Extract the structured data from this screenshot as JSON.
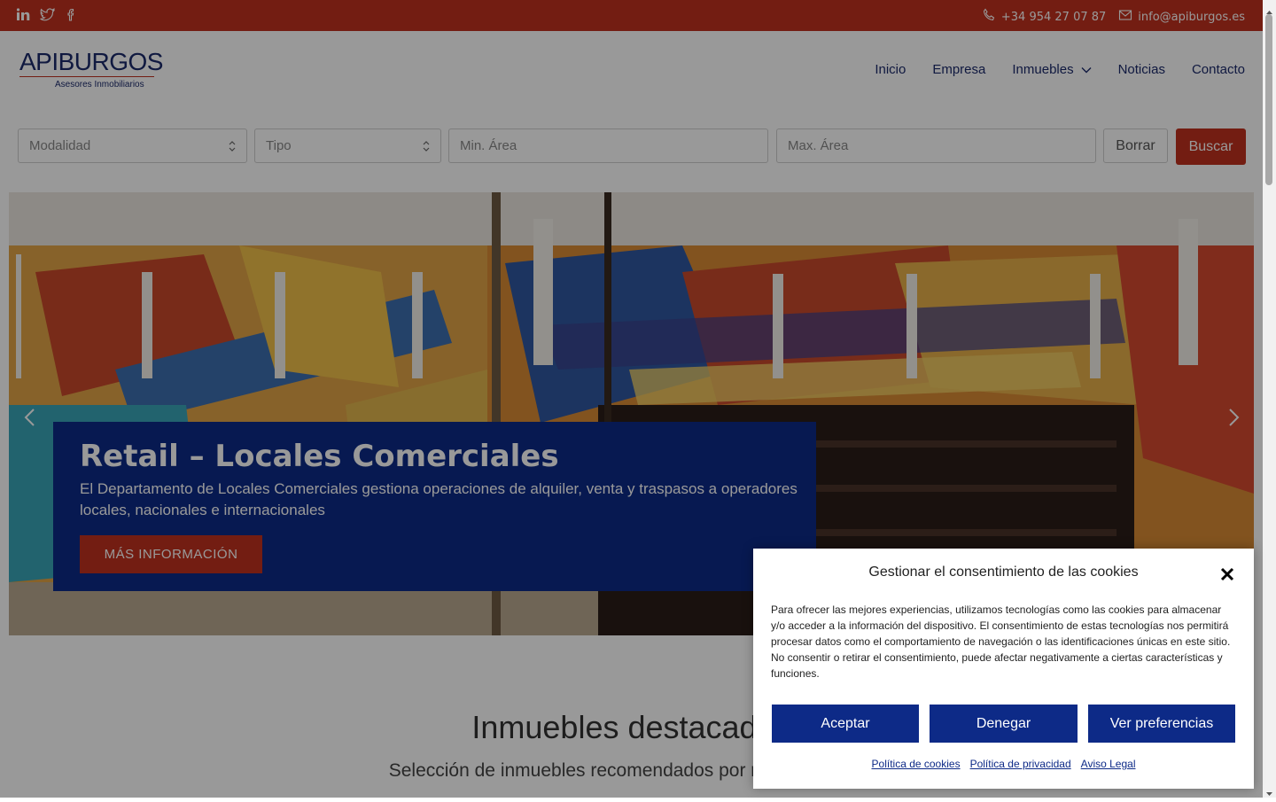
{
  "topbar": {
    "social": [
      "linkedin-icon",
      "twitter-icon",
      "facebook-icon"
    ],
    "phone": "+34 954 27 07 87",
    "email": "info@apiburgos.es"
  },
  "logo": {
    "brand": "APIBURGOS",
    "tagline": "Asesores Inmobiliarios"
  },
  "nav": {
    "items": [
      "Inicio",
      "Empresa",
      "Inmuebles",
      "Noticias",
      "Contacto"
    ]
  },
  "search": {
    "modalidad": "Modalidad",
    "tipo": "Tipo",
    "min_area_placeholder": "Min. Área",
    "max_area_placeholder": "Max. Área",
    "clear": "Borrar",
    "submit": "Buscar"
  },
  "hero": {
    "title": "Retail – Locales Comerciales",
    "description": "El Departamento de Locales Comerciales gestiona operaciones de alquiler, venta y traspasos a operadores locales, nacionales e internacionales",
    "cta": "MÁS INFORMACIÓN"
  },
  "featured": {
    "title": "Inmuebles destacados",
    "subtitle": "Selección de inmuebles recomendados por nuestro equipo"
  },
  "cookie": {
    "title": "Gestionar el consentimiento de las cookies",
    "text": "Para ofrecer las mejores experiencias, utilizamos tecnologías como las cookies para almacenar y/o acceder a la información del dispositivo. El consentimiento de estas tecnologías nos permitirá procesar datos como el comportamiento de navegación o las identificaciones únicas en este sitio. No consentir o retirar el consentimiento, puede afectar negativamente a ciertas características y funciones.",
    "accept": "Aceptar",
    "deny": "Denegar",
    "preferences": "Ver preferencias",
    "links": [
      "Política de cookies",
      "Política de privacidad",
      "Aviso Legal"
    ]
  },
  "colors": {
    "brand_red": "#c0311f",
    "brand_blue": "#0d2a87",
    "navy_text": "#1c2a6b"
  }
}
